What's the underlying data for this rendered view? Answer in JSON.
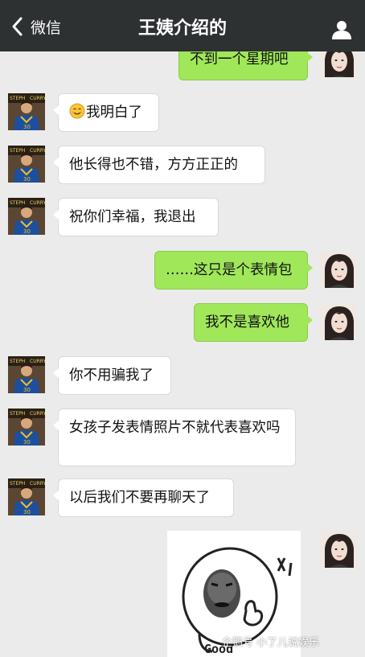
{
  "header": {
    "back_label": "微信",
    "title": "王姨介绍的"
  },
  "messages": [
    {
      "side": "right",
      "text": "不到一个星期吧"
    },
    {
      "side": "left",
      "emoji": "smile-emoji",
      "text": "我明白了"
    },
    {
      "side": "left",
      "text": "他长得也不错，方方正正的"
    },
    {
      "side": "left",
      "text": "祝你们幸福，我退出"
    },
    {
      "side": "right",
      "text": "……这只是个表情包"
    },
    {
      "side": "right",
      "text": "我不是喜欢他"
    },
    {
      "side": "left",
      "text": "你不用骗我了"
    },
    {
      "side": "left",
      "text": "女孩子发表情照片不就代表喜欢吗"
    },
    {
      "side": "left",
      "text": "以后我们不要再聊天了"
    },
    {
      "side": "right",
      "type": "sticker",
      "caption": "Good"
    }
  ],
  "avatar_left_text": {
    "top_left": "STEPH",
    "top_right": "CURRY",
    "jersey": "30"
  },
  "watermark": "企鹅号 小了儿说娱乐",
  "colors": {
    "topbar": "#2e3132",
    "background": "#ebebeb",
    "bubble_right": "#a0e75a",
    "bubble_left": "#ffffff",
    "jersey": "#1d4fa0"
  }
}
